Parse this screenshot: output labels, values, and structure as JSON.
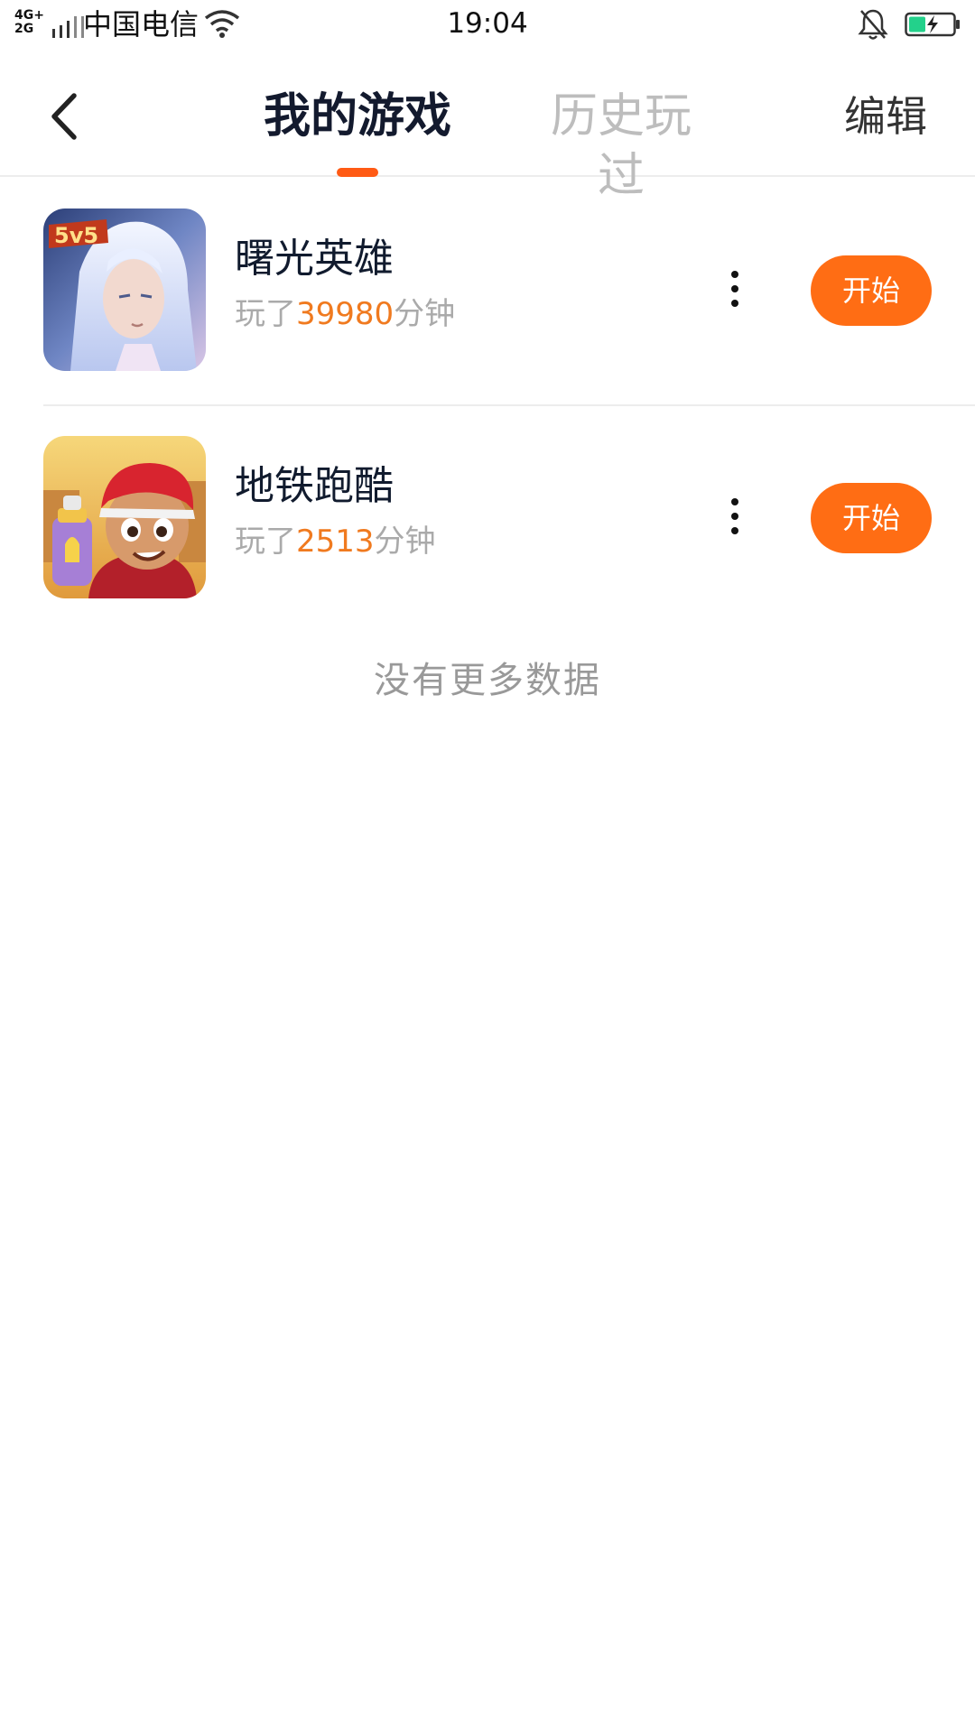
{
  "status_bar": {
    "network": "4G+\n2G",
    "carrier": "中国电信",
    "time": "19:04",
    "icons": [
      "signal-bars-icon",
      "wifi-icon",
      "bell-muted-icon",
      "battery-charging-icon"
    ]
  },
  "header": {
    "back_icon": "chevron-left-icon",
    "tabs": [
      {
        "label": "我的游戏",
        "active": true
      },
      {
        "label": "历史玩过",
        "active": false
      }
    ],
    "edit_label": "编辑",
    "accent_color": "#ff5a14"
  },
  "games": [
    {
      "name": "曙光英雄",
      "played_prefix": "玩了",
      "minutes": "39980",
      "played_suffix": "分钟",
      "icon_badge": "5v5",
      "more_icon": "more-vertical-icon",
      "start_label": "开始"
    },
    {
      "name": "地铁跑酷",
      "played_prefix": "玩了",
      "minutes": "2513",
      "played_suffix": "分钟",
      "more_icon": "more-vertical-icon",
      "start_label": "开始"
    }
  ],
  "footer_text": "没有更多数据",
  "colors": {
    "start_button": "#ff6d14",
    "minutes_highlight": "#f07a1f",
    "inactive_tab": "#bdbdbd"
  }
}
